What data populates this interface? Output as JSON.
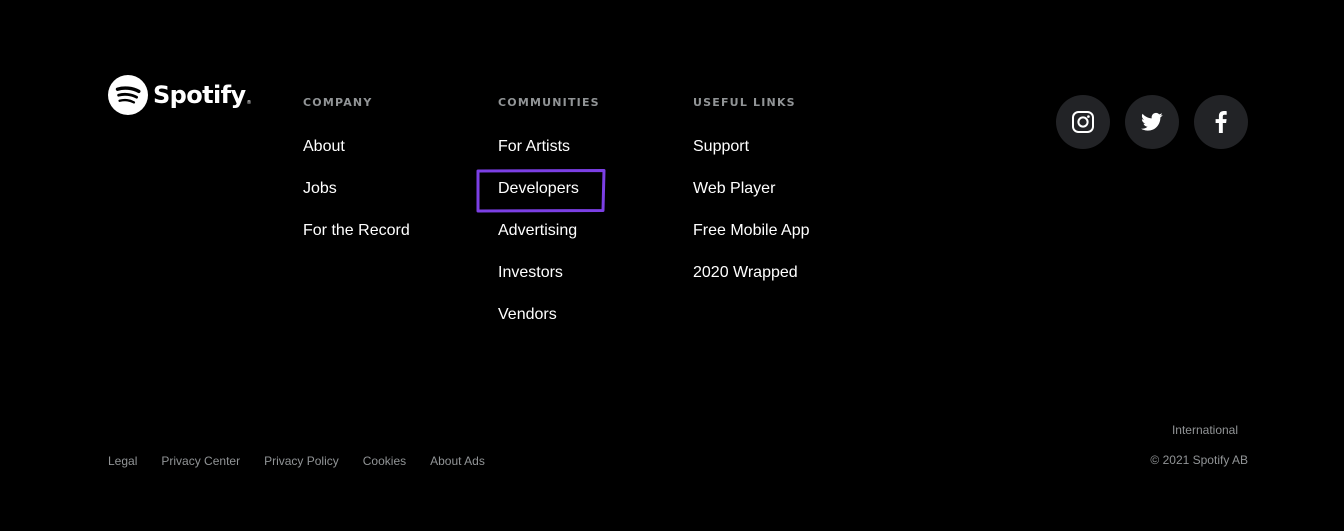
{
  "brand": {
    "wordmark": "Spotify",
    "trademark": "®",
    "color": "#ffffff"
  },
  "columns": {
    "company": {
      "heading": "COMPANY",
      "links": [
        "About",
        "Jobs",
        "For the Record"
      ]
    },
    "communities": {
      "heading": "COMMUNITIES",
      "links": [
        "For Artists",
        "Developers",
        "Advertising",
        "Investors",
        "Vendors"
      ]
    },
    "useful_links": {
      "heading": "USEFUL LINKS",
      "links": [
        "Support",
        "Web Player",
        "Free Mobile App",
        "2020 Wrapped"
      ]
    }
  },
  "social": [
    {
      "name": "instagram-icon"
    },
    {
      "name": "twitter-icon"
    },
    {
      "name": "facebook-icon"
    }
  ],
  "legal": {
    "links": [
      "Legal",
      "Privacy Center",
      "Privacy Policy",
      "Cookies",
      "About Ads"
    ]
  },
  "country": "International",
  "copyright": "© 2021 Spotify AB",
  "colors": {
    "background": "#000000",
    "heading": "#919496",
    "link": "#ffffff",
    "muted": "#919496",
    "social_bg": "#222326",
    "highlight": "#7b3fe4"
  }
}
